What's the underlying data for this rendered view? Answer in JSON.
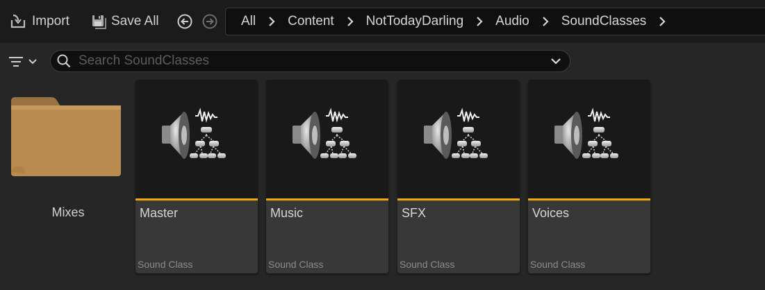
{
  "toolbar": {
    "import_label": "Import",
    "save_all_label": "Save All"
  },
  "breadcrumb": [
    "All",
    "Content",
    "NotTodayDarling",
    "Audio",
    "SoundClasses"
  ],
  "search": {
    "placeholder": "Search SoundClasses",
    "value": ""
  },
  "folders": [
    {
      "label": "Mixes"
    }
  ],
  "assets": [
    {
      "name": "Master",
      "type": "Sound Class"
    },
    {
      "name": "Music",
      "type": "Sound Class"
    },
    {
      "name": "SFX",
      "type": "Sound Class"
    },
    {
      "name": "Voices",
      "type": "Sound Class"
    }
  ],
  "colors": {
    "accent": "#f2a80a",
    "toolbar_bg": "#1b1b1b",
    "panel_bg": "#262626",
    "folder": "#b98b4e"
  },
  "icons": {
    "import": "import-icon",
    "save_all": "save-icon",
    "back": "back-arrow-icon",
    "forward": "forward-arrow-icon",
    "breadcrumb_separator": "chevron-right-icon",
    "filter": "filter-icon",
    "search": "search-icon",
    "search_options": "chevron-down-icon",
    "folder": "folder-icon",
    "asset_thumbnail": "sound-class-icon"
  }
}
